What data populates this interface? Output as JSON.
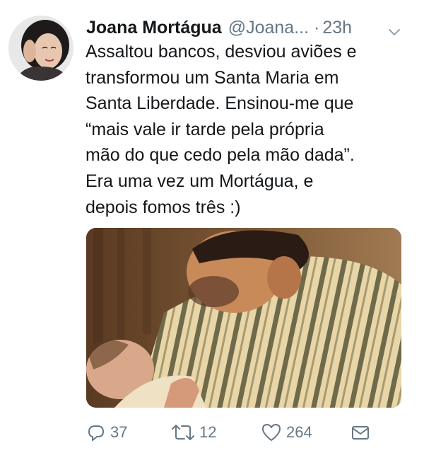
{
  "author": {
    "name": "Joana Mortágua",
    "handle": "@Joana...",
    "separator": "·",
    "time": "23h"
  },
  "tweet": {
    "lines": [
      "Assaltou bancos, desviou aviões e",
      "transformou um Santa Maria em",
      "Santa Liberdade. Ensinou-me que",
      "“mais vale ir tarde pela própria",
      "mão do que cedo pela mão dada”.",
      "Era uma vez um Mortágua, e",
      "depois fomos três :)"
    ]
  },
  "actions": {
    "replies": "37",
    "retweets": "12",
    "likes": "264"
  },
  "icons": {
    "menu": "chevron-down-icon",
    "reply": "reply-icon",
    "retweet": "retweet-icon",
    "like": "heart-icon",
    "message": "envelope-icon"
  },
  "colors": {
    "text": "#14171a",
    "secondary": "#657786",
    "background": "#ffffff"
  }
}
